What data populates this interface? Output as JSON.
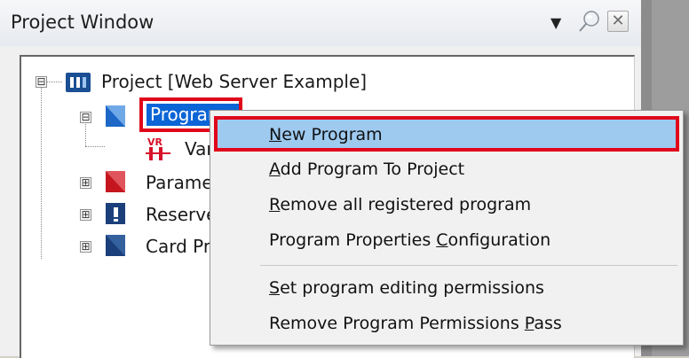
{
  "window": {
    "title": "Project Window",
    "dropdown_glyph": "▼",
    "pin_icon": "pushpin-icon",
    "close_glyph": "✕"
  },
  "tree": {
    "root": {
      "label": "Project [Web Server Example]",
      "expander": "⊟"
    },
    "program": {
      "label": "Program",
      "expander": "⊟"
    },
    "variable": {
      "label": "Var",
      "icon_text": "VR"
    },
    "parameter": {
      "label": "Parame",
      "expander": "⊞"
    },
    "reserved": {
      "label": "Reserve",
      "expander": "⊞"
    },
    "card": {
      "label": "Card Pr",
      "expander": "⊞"
    }
  },
  "context_menu": {
    "items": [
      {
        "pre": "",
        "acc": "N",
        "post": "ew Program"
      },
      {
        "pre": "",
        "acc": "A",
        "post": "dd Program To Project"
      },
      {
        "pre": "",
        "acc": "R",
        "post": "emove all registered program"
      },
      {
        "pre": "Program Properties ",
        "acc": "C",
        "post": "onfiguration"
      },
      {
        "pre": "",
        "acc": "S",
        "post": "et program editing permissions"
      },
      {
        "pre": "Remove Program Permissions ",
        "acc": "P",
        "post": "ass"
      }
    ]
  },
  "colors": {
    "highlight_box": "#e0061a",
    "selection": "#0b65d6",
    "menu_hover": "#9ecaf0"
  }
}
